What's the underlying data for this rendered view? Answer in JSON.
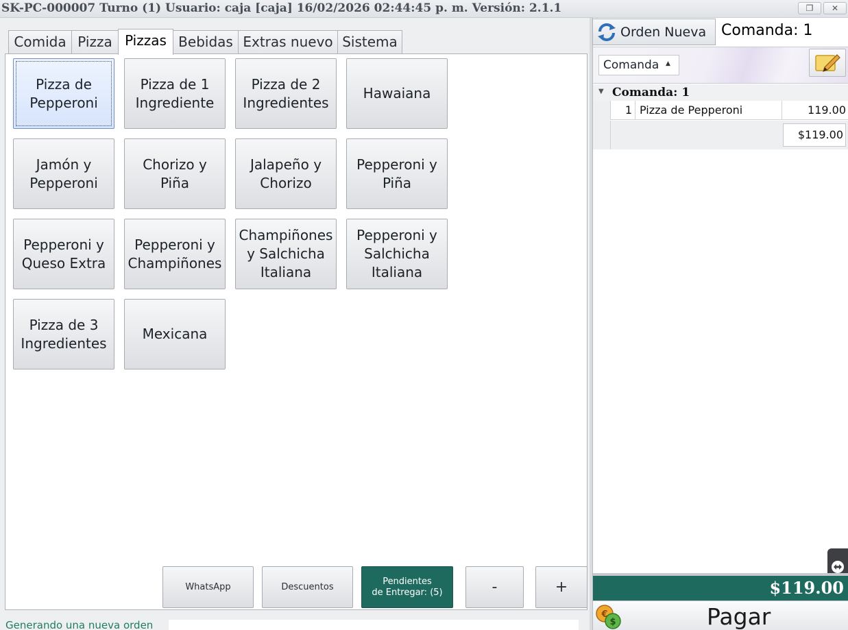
{
  "window": {
    "title": "SK-PC-000007 Turno (1) Usuario: caja [caja] 16/02/2026 02:44:45 p. m. Versión: 2.1.1",
    "restore_icon": "restore-window-icon",
    "close_icon": "close-window-icon"
  },
  "tabs": [
    {
      "label": "Comida",
      "active": false
    },
    {
      "label": "Pizza",
      "active": false
    },
    {
      "label": "Pizzas",
      "active": true
    },
    {
      "label": "Bebidas",
      "active": false
    },
    {
      "label": "Extras nuevo",
      "active": false
    },
    {
      "label": "Sistema",
      "active": false
    }
  ],
  "products": [
    {
      "lines": [
        "Pizza de",
        "Pepperoni"
      ],
      "selected": true
    },
    {
      "lines": [
        "Pizza de 1",
        "Ingrediente"
      ]
    },
    {
      "lines": [
        "Pizza de 2",
        "Ingredientes"
      ]
    },
    {
      "lines": [
        "Hawaiana"
      ]
    },
    {
      "lines": [
        "Jamón y",
        "Pepperoni"
      ]
    },
    {
      "lines": [
        "Chorizo y Piña"
      ]
    },
    {
      "lines": [
        "Jalapeño y",
        "Chorizo"
      ]
    },
    {
      "lines": [
        "Pepperoni y",
        "Piña"
      ]
    },
    {
      "lines": [
        "Pepperoni y",
        "Queso Extra"
      ]
    },
    {
      "lines": [
        "Pepperoni y",
        "Champiñones"
      ]
    },
    {
      "lines": [
        "Champiñones",
        "y Salchicha",
        "Italiana"
      ]
    },
    {
      "lines": [
        "Pepperoni y",
        "Salchicha",
        "Italiana"
      ]
    },
    {
      "lines": [
        "Pizza de 3",
        "Ingredientes"
      ]
    },
    {
      "lines": [
        "Mexicana"
      ]
    }
  ],
  "actions": {
    "whatsapp": "WhatsApp",
    "descuentos": "Descuentos",
    "pendientes_line1": "Pendientes",
    "pendientes_line2": "de Entregar: (5)",
    "minus": "-",
    "plus": "+"
  },
  "status": {
    "message": "Generando una nueva orden"
  },
  "order": {
    "new_order_label": "Orden Nueva",
    "new_order_icon": "refresh-icon",
    "comanda_header": "Comanda: 1",
    "view_select": "Comanda",
    "note_icon": "edit-note-icon",
    "group_label": "Comanda: 1",
    "items": [
      {
        "qty": "1",
        "name": "Pizza de Pepperoni",
        "price": "119.00"
      }
    ],
    "group_total": "$119.00",
    "grand_total": "$119.00",
    "pay_label": "Pagar",
    "pay_icon": "coins-icon"
  },
  "colors": {
    "accent_green": "#1f6a5e"
  }
}
